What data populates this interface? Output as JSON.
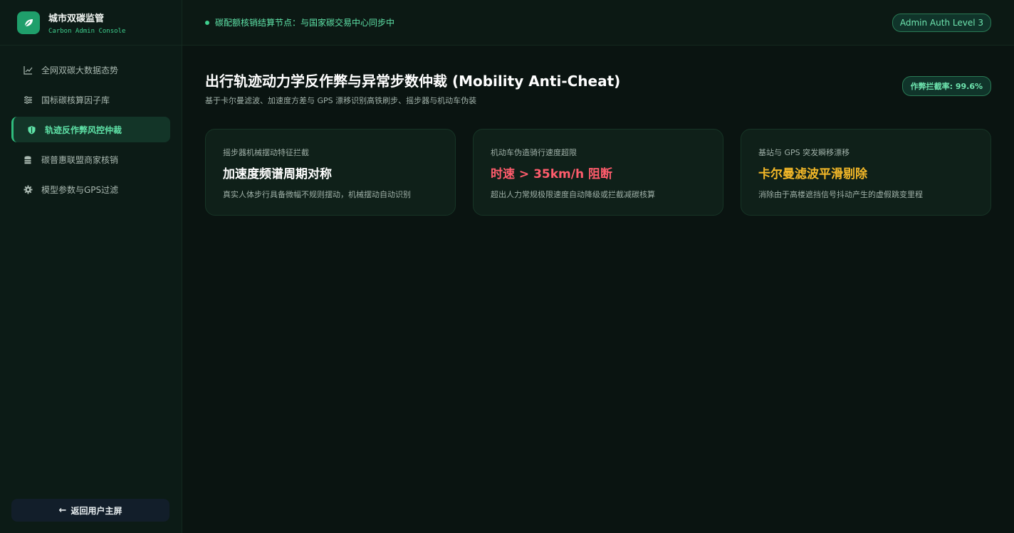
{
  "brand": {
    "title": "城市双碳监管",
    "subtitle": "Carbon Admin Console"
  },
  "sidebar": {
    "items": [
      {
        "label": "全网双碳大数据态势",
        "icon": "chart-line-icon"
      },
      {
        "label": "国标碳核算因子库",
        "icon": "sliders-icon"
      },
      {
        "label": "轨迹反作弊风控仲裁",
        "icon": "shield-icon",
        "active": true
      },
      {
        "label": "碳普惠联盟商家核销",
        "icon": "coins-icon"
      },
      {
        "label": "模型参数与GPS过滤",
        "icon": "gear-icon"
      }
    ],
    "back_label": "返回用户主屏"
  },
  "topbar": {
    "sync_text": "碳配额核销结算节点：与国家碳交易中心同步中",
    "auth_badge": "Admin Auth Level 3"
  },
  "main": {
    "title": "出行轨迹动力学反作弊与异常步数仲裁 (Mobility Anti-Cheat)",
    "subtitle": "基于卡尔曼滤波、加速度方差与 GPS 漂移识别高铁刷步、摇步器与机动车伪装",
    "rate_badge": "作弊拦截率: 99.6%",
    "cards": [
      {
        "label": "摇步器机械摆动特征拦截",
        "value": "加速度频谱周期对称",
        "desc": "真实人体步行具备微幅不规则摆动，机械摆动自动识别",
        "color": "#ffffff"
      },
      {
        "label": "机动车伪造骑行速度超限",
        "value": "时速 > 35km/h 阻断",
        "desc": "超出人力常规极限速度自动降级或拦截减碳核算",
        "color": "#ff5c6c"
      },
      {
        "label": "基站与 GPS 突发瞬移漂移",
        "value": "卡尔曼滤波平滑剔除",
        "desc": "消除由于高楼遮挡信号抖动产生的虚假跳变里程",
        "color": "#f5b928"
      }
    ]
  },
  "colors": {
    "accent": "#3fcf8e",
    "background": "#0a1411",
    "danger": "#ff5c6c",
    "warning": "#f5b928"
  }
}
